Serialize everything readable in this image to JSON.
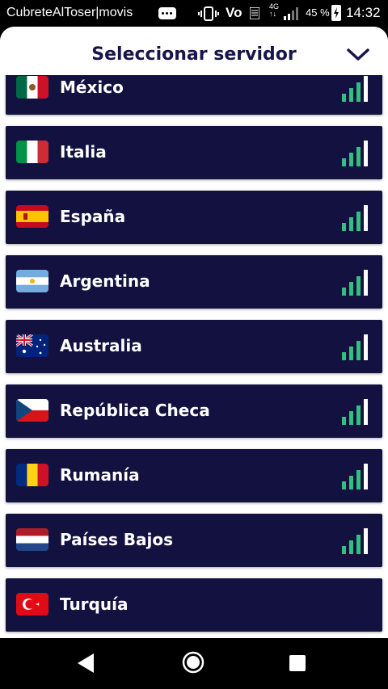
{
  "status_bar": {
    "app_text": "CubreteAlToser|movis",
    "network": "4G",
    "battery": "45 %",
    "time": "14:32",
    "volte": "Vo"
  },
  "sheet": {
    "title": "Seleccionar servidor",
    "close_icon": "chevron-down-icon"
  },
  "servers": [
    {
      "country": "México",
      "flag": "mexico",
      "signal_bars": 4
    },
    {
      "country": "Italia",
      "flag": "italy",
      "signal_bars": 4
    },
    {
      "country": "España",
      "flag": "spain",
      "signal_bars": 4
    },
    {
      "country": "Argentina",
      "flag": "argentina",
      "signal_bars": 4
    },
    {
      "country": "Australia",
      "flag": "australia",
      "signal_bars": 4
    },
    {
      "country": "República Checa",
      "flag": "czech-republic",
      "signal_bars": 4
    },
    {
      "country": "Rumanía",
      "flag": "romania",
      "signal_bars": 4
    },
    {
      "country": "Países Bajos",
      "flag": "netherlands",
      "signal_bars": 4
    },
    {
      "country": "Turquía",
      "flag": "turkey",
      "signal_bars": 0
    }
  ],
  "colors": {
    "row_bg": "#13113f",
    "title": "#17154a",
    "signal_green": "#2ec27e",
    "signal_white": "#ffffff"
  },
  "nav_bar": {
    "back_icon": "back-triangle-icon",
    "home_icon": "home-circle-icon",
    "recents_icon": "recents-square-icon"
  }
}
